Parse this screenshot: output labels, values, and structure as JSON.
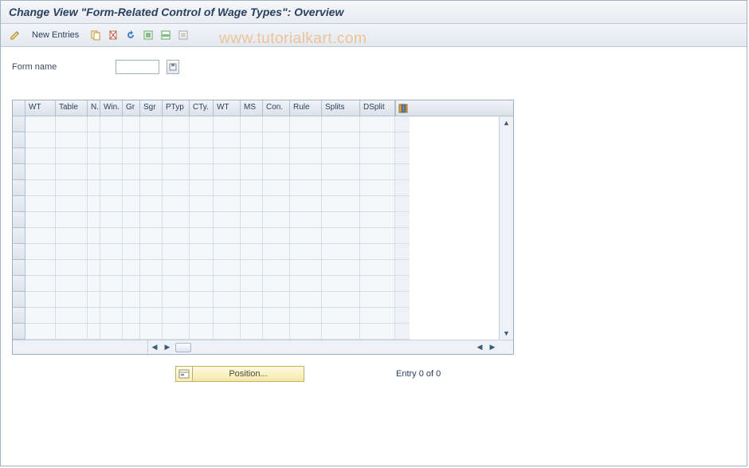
{
  "title": "Change View \"Form-Related Control of Wage Types\": Overview",
  "toolbar": {
    "new_entries": "New Entries"
  },
  "watermark": "www.tutorialkart.com",
  "form": {
    "label": "Form name",
    "value": ""
  },
  "table": {
    "columns": [
      {
        "key": "wt",
        "label": "WT",
        "w": 38
      },
      {
        "key": "table",
        "label": "Table",
        "w": 40
      },
      {
        "key": "n",
        "label": "N..",
        "w": 16
      },
      {
        "key": "win",
        "label": "Win.",
        "w": 28
      },
      {
        "key": "gr",
        "label": "Gr",
        "w": 22
      },
      {
        "key": "sgr",
        "label": "Sgr",
        "w": 28
      },
      {
        "key": "ptyp",
        "label": "PTyp",
        "w": 34
      },
      {
        "key": "cty",
        "label": "CTy.",
        "w": 30
      },
      {
        "key": "wt2",
        "label": "WT",
        "w": 34
      },
      {
        "key": "ms",
        "label": "MS",
        "w": 28
      },
      {
        "key": "con",
        "label": "Con.",
        "w": 34
      },
      {
        "key": "rule",
        "label": "Rule",
        "w": 40
      },
      {
        "key": "splits",
        "label": "Splits",
        "w": 48
      },
      {
        "key": "dsplit",
        "label": "DSplit",
        "w": 44
      }
    ],
    "row_count": 14
  },
  "footer": {
    "position_label": "Position...",
    "entry_text": "Entry 0 of 0"
  }
}
